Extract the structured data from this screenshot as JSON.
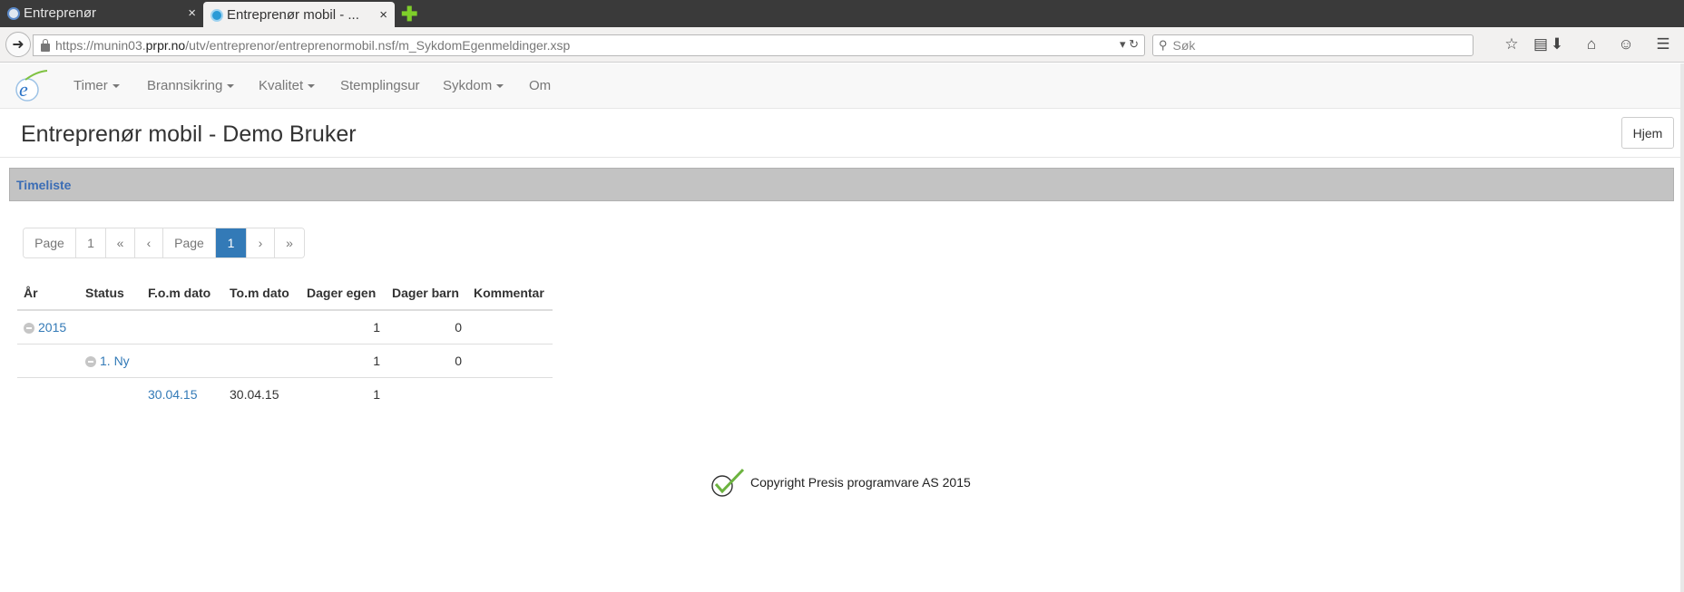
{
  "browser": {
    "tabs": [
      {
        "label": "Entreprenør"
      },
      {
        "label": "Entreprenør mobil - ..."
      }
    ],
    "new_tab_glyph": "✚",
    "close_glyph": "×",
    "url_prefix": "https://munin03.",
    "url_host": "prpr.no",
    "url_path": "/utv/entreprenor/entreprenormobil.nsf/m_SykdomEgenmeldinger.xsp",
    "search_placeholder": "Søk",
    "toolbar_icons": [
      "star-icon",
      "reading-list-icon",
      "download-icon",
      "home-icon",
      "chat-icon",
      "menu-icon"
    ]
  },
  "nav": {
    "items": [
      {
        "label": "Timer",
        "dropdown": true
      },
      {
        "label": "Brannsikring",
        "dropdown": true
      },
      {
        "label": "Kvalitet",
        "dropdown": true
      },
      {
        "label": "Stemplingsur",
        "dropdown": false
      },
      {
        "label": "Sykdom",
        "dropdown": true
      },
      {
        "label": "Om",
        "dropdown": false
      }
    ]
  },
  "header": {
    "title": "Entreprenør mobil - Demo Bruker",
    "home_button": "Hjem"
  },
  "section": {
    "title": "Timeliste"
  },
  "pager": {
    "items": [
      "Page",
      "1",
      "«",
      "‹",
      "Page",
      "1",
      "›",
      "»"
    ],
    "active_index": 5
  },
  "table": {
    "columns": [
      "År",
      "Status",
      "F.o.m dato",
      "To.m dato",
      "Dager egen",
      "Dager barn",
      "Kommentar"
    ],
    "rows": [
      {
        "year": "2015",
        "status": "",
        "from": "",
        "to": "",
        "days_own": "1",
        "days_child": "0",
        "comment": ""
      },
      {
        "year": "",
        "status": "1. Ny",
        "from": "",
        "to": "",
        "days_own": "1",
        "days_child": "0",
        "comment": ""
      },
      {
        "year": "",
        "status": "",
        "from": "30.04.15",
        "to": "30.04.15",
        "days_own": "1",
        "days_child": "",
        "comment": ""
      }
    ]
  },
  "footer": {
    "copyright": "Copyright Presis programvare AS 2015"
  },
  "colors": {
    "link": "#337ab7",
    "pager_active": "#337ab7",
    "section_bar": "#c3c3c3",
    "section_title": "#3b6db5"
  }
}
